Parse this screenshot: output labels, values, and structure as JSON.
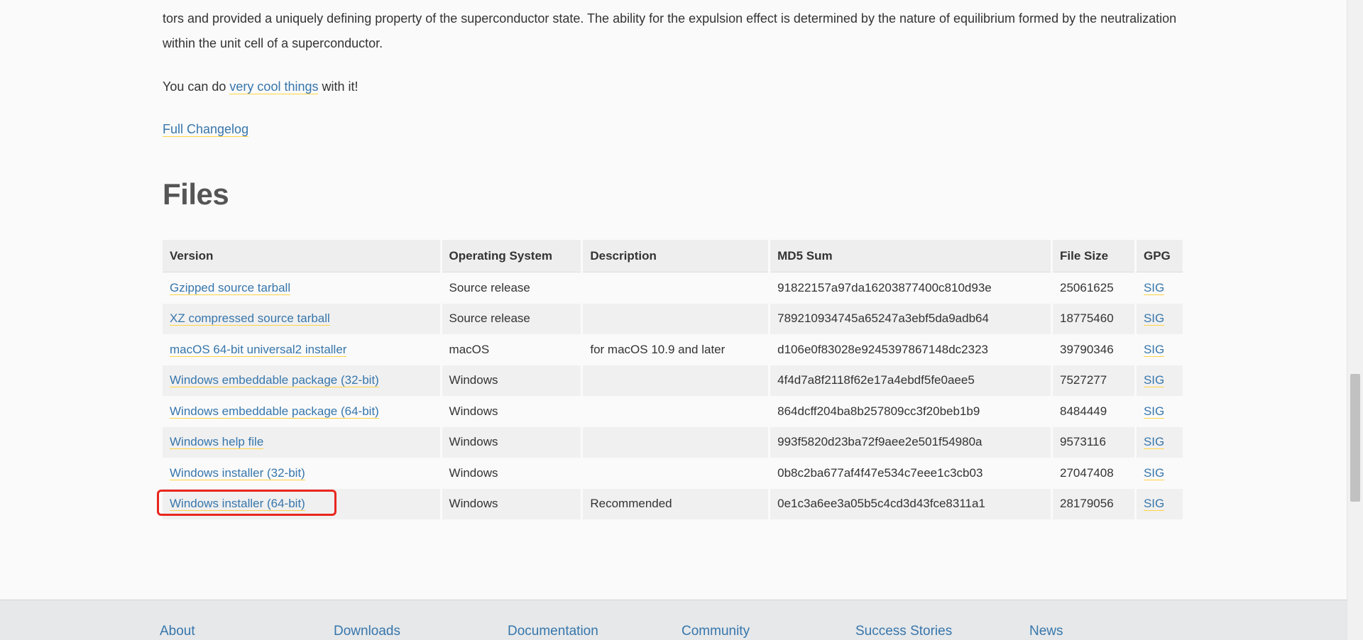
{
  "intro": {
    "para1": "tors and provided a uniquely defining property of the superconductor state. The ability for the expulsion effect is determined by the nature of equilibrium formed by the neutralization within the unit cell of a superconductor.",
    "para2_prefix": "You can do ",
    "para2_link": "very cool things",
    "para2_suffix": " with it!",
    "changelog_link": "Full Changelog"
  },
  "files": {
    "heading": "Files",
    "columns": [
      "Version",
      "Operating System",
      "Description",
      "MD5 Sum",
      "File Size",
      "GPG"
    ],
    "rows": [
      {
        "version": "Gzipped source tarball",
        "os": "Source release",
        "description": "",
        "md5": "91822157a97da16203877400c810d93e",
        "size": "25061625",
        "gpg": "SIG"
      },
      {
        "version": "XZ compressed source tarball",
        "os": "Source release",
        "description": "",
        "md5": "789210934745a65247a3ebf5da9adb64",
        "size": "18775460",
        "gpg": "SIG"
      },
      {
        "version": "macOS 64-bit universal2 installer",
        "os": "macOS",
        "description": "for macOS 10.9 and later",
        "md5": "d106e0f83028e9245397867148dc2323",
        "size": "39790346",
        "gpg": "SIG"
      },
      {
        "version": "Windows embeddable package (32-bit)",
        "os": "Windows",
        "description": "",
        "md5": "4f4d7a8f2118f62e17a4ebdf5fe0aee5",
        "size": "7527277",
        "gpg": "SIG"
      },
      {
        "version": "Windows embeddable package (64-bit)",
        "os": "Windows",
        "description": "",
        "md5": "864dcff204ba8b257809cc3f20beb1b9",
        "size": "8484449",
        "gpg": "SIG"
      },
      {
        "version": "Windows help file",
        "os": "Windows",
        "description": "",
        "md5": "993f5820d23ba72f9aee2e501f54980a",
        "size": "9573116",
        "gpg": "SIG"
      },
      {
        "version": "Windows installer (32-bit)",
        "os": "Windows",
        "description": "",
        "md5": "0b8c2ba677af4f47e534c7eee1c3cb03",
        "size": "27047408",
        "gpg": "SIG"
      },
      {
        "version": "Windows installer (64-bit)",
        "os": "Windows",
        "description": "Recommended",
        "md5": "0e1c3a6ee3a05b5c4cd3d43fce8311a1",
        "size": "28179056",
        "gpg": "SIG"
      }
    ]
  },
  "footer": {
    "nav": [
      "About",
      "Downloads",
      "Documentation",
      "Community",
      "Success Stories",
      "News"
    ]
  },
  "colors": {
    "link": "#3776ab",
    "link_underline": "#ffd343",
    "highlight_border": "#e8271e"
  }
}
